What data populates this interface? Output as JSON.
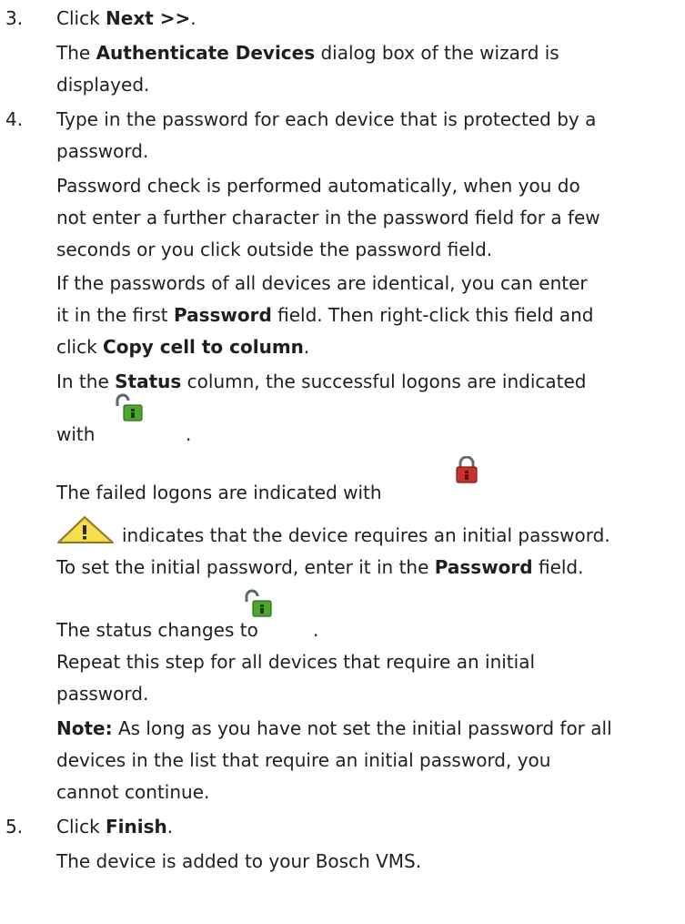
{
  "steps": [
    {
      "number": "3.",
      "action": {
        "prefix": "Click ",
        "bold": "Next >>",
        "suffix": "."
      },
      "result_line1": {
        "prefix": "The ",
        "bold": "Authenticate Devices",
        "suffix": " dialog box of the wizard is"
      },
      "result_line2": "displayed."
    },
    {
      "number": "4.",
      "action_line1": "Type in the password for each device that is protected by a",
      "action_line2": "password.",
      "check_line1": "Password check is performed automatically, when you do",
      "check_line2": "not enter a further character in the password field for a few",
      "check_line3": "seconds or you click outside the password field.",
      "identical_line1": "If the passwords of all devices are identical, you can enter",
      "identical_line2": {
        "prefix": "it in the first ",
        "bold": "Password",
        "suffix": " field. Then right-click this field and"
      },
      "identical_line3": {
        "prefix": "click ",
        "bold": "Copy cell to column",
        "suffix": "."
      },
      "status_line": {
        "prefix": "In the ",
        "bold": "Status",
        "suffix": " column, the successful logons are indicated"
      },
      "with_word": "with",
      "with_period": ".",
      "failed_line": "The failed logons are indicated with",
      "warning_line": "indicates that the device requires an initial password.",
      "set_line": {
        "prefix": "To set the initial password, enter it in the ",
        "bold": "Password",
        "suffix": " field."
      },
      "changes_line": "The status changes to",
      "changes_period": ".",
      "repeat_line1": "Repeat this step for all devices that require an initial",
      "repeat_line2": "password.",
      "note_line1": {
        "bold": "Note:",
        "suffix": " As long as you have not set the initial password for all"
      },
      "note_line2": "devices in the list that require an initial password, you",
      "note_line3": "cannot continue."
    },
    {
      "number": "5.",
      "action": {
        "prefix": "Click ",
        "bold": "Finish",
        "suffix": "."
      },
      "result": "The device is added to your Bosch VMS."
    }
  ],
  "icons": {
    "success": "unlocked-padlock-green-icon",
    "failed": "locked-padlock-red-icon",
    "warning": "warning-triangle-icon"
  },
  "colors": {
    "text": "#1f1f1f",
    "success_green": "#4fa52f",
    "failed_red": "#c8322a",
    "warning_yellow": "#f2d33a"
  }
}
